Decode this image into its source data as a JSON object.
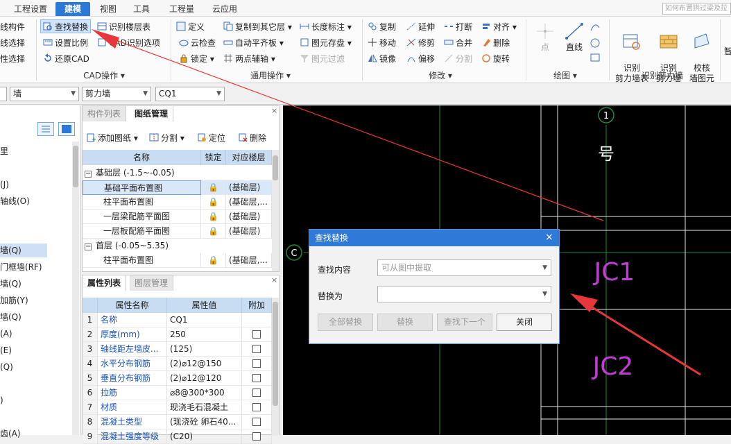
{
  "menubar": {
    "tabs": [
      "工程设置",
      "建模",
      "视图",
      "工具",
      "工程量",
      "云应用"
    ],
    "active_tab": "建模",
    "search_placeholder": "如何布置拱过梁及拉"
  },
  "ribbon": {
    "group_cad_left": [
      "线构件",
      "线选择",
      "性选择"
    ],
    "group_cad": {
      "items": [
        "查找替换",
        "识别楼层表",
        "设置比例",
        "CAD识别选项",
        "还原CAD"
      ],
      "label": "CAD操作"
    },
    "group_common": {
      "items": [
        "定义",
        "复制到其它层",
        "长度标注",
        "云检查",
        "自动平齐板",
        "图元存盘",
        "锁定",
        "两点辅轴",
        "图元过滤"
      ],
      "label": "通用操作"
    },
    "group_modify": {
      "items": [
        "复制",
        "延伸",
        "打断",
        "对齐",
        "移动",
        "修剪",
        "合并",
        "删除",
        "镜像",
        "偏移",
        "分割",
        "旋转"
      ],
      "label": "修改"
    },
    "group_draw": {
      "items": [
        "点",
        "直线"
      ],
      "label": "绘图"
    },
    "group_recognize": {
      "items": [
        "识别\n剪力墙表",
        "识别\n剪力墙",
        "校核\n墙图元"
      ],
      "label": "识别剪力墙"
    },
    "overflow_label": "智"
  },
  "selectors": [
    "墙",
    "剪力墙",
    "CQ1"
  ],
  "left_panel": {
    "items": [
      "里",
      "(J)",
      "轴线(O)",
      "墙(Q)",
      "门框墙(RF)",
      "墙(Q)",
      "加筋(Y)",
      "墙(Q)",
      "(A)",
      "(E)",
      "(Q)",
      ")",
      "齿(A)"
    ]
  },
  "drawing_panel": {
    "tabs": [
      "构件列表",
      "图纸管理"
    ],
    "active_tab": "图纸管理",
    "toolbar": [
      "添加图纸",
      "分割",
      "定位",
      "删除"
    ],
    "columns": [
      "名称",
      "锁定",
      "对应楼层"
    ],
    "groups": [
      {
        "title": "基础层 (-1.5~-0.05)",
        "rows": [
          {
            "name": "基础平面布置图",
            "floor": "(基础层)"
          },
          {
            "name": "柱平面布置图",
            "floor": "(基础层,..."
          },
          {
            "name": "一层梁配筋平面图",
            "floor": "(基础层)"
          },
          {
            "name": "一层板配筋平面图",
            "floor": "(基础层)"
          }
        ]
      },
      {
        "title": "首层 (-0.05~5.35)",
        "rows": [
          {
            "name": "柱平面布置图",
            "floor": "(基础层,..."
          }
        ]
      }
    ]
  },
  "property_panel": {
    "tabs": [
      "属性列表",
      "图层管理"
    ],
    "active_tab": "属性列表",
    "columns": [
      "属性名称",
      "属性值",
      "附加"
    ],
    "rows": [
      {
        "no": "1",
        "name": "名称",
        "value": "CQ1",
        "check": false
      },
      {
        "no": "2",
        "name": "厚度(mm)",
        "value": "250",
        "check": true
      },
      {
        "no": "3",
        "name": "轴线距左墙皮...",
        "value": "(125)",
        "check": true
      },
      {
        "no": "4",
        "name": "水平分布钢筋",
        "value": "(2)⌀12@150",
        "check": true
      },
      {
        "no": "5",
        "name": "垂直分布钢筋",
        "value": "(2)⌀12@120",
        "check": true
      },
      {
        "no": "6",
        "name": "拉筋",
        "value": "⌀8@300*300",
        "check": true
      },
      {
        "no": "7",
        "name": "材质",
        "value": "现浇毛石混凝土",
        "check": true
      },
      {
        "no": "8",
        "name": "混凝土类型",
        "value": "(现浇砼 卵石40...",
        "check": true
      },
      {
        "no": "9",
        "name": "混凝土强度等级",
        "value": "(C20)",
        "check": true
      }
    ]
  },
  "canvas": {
    "axis_labels": [
      "1",
      "C"
    ],
    "text_labels": [
      "号",
      "JC1",
      "JC2"
    ]
  },
  "dialog": {
    "title": "查找替换",
    "find_label": "查找内容",
    "find_placeholder": "可从图中提取",
    "replace_label": "替换为",
    "replace_value": "",
    "buttons": [
      "全部替换",
      "替换",
      "查找下一个",
      "关闭"
    ]
  },
  "colors": {
    "accent": "#2b79d6",
    "canvas_bg": "#000000",
    "grid_green": "#1f8a3a",
    "label_magenta": "#c23bd6",
    "arrow_red": "#e8373a"
  }
}
